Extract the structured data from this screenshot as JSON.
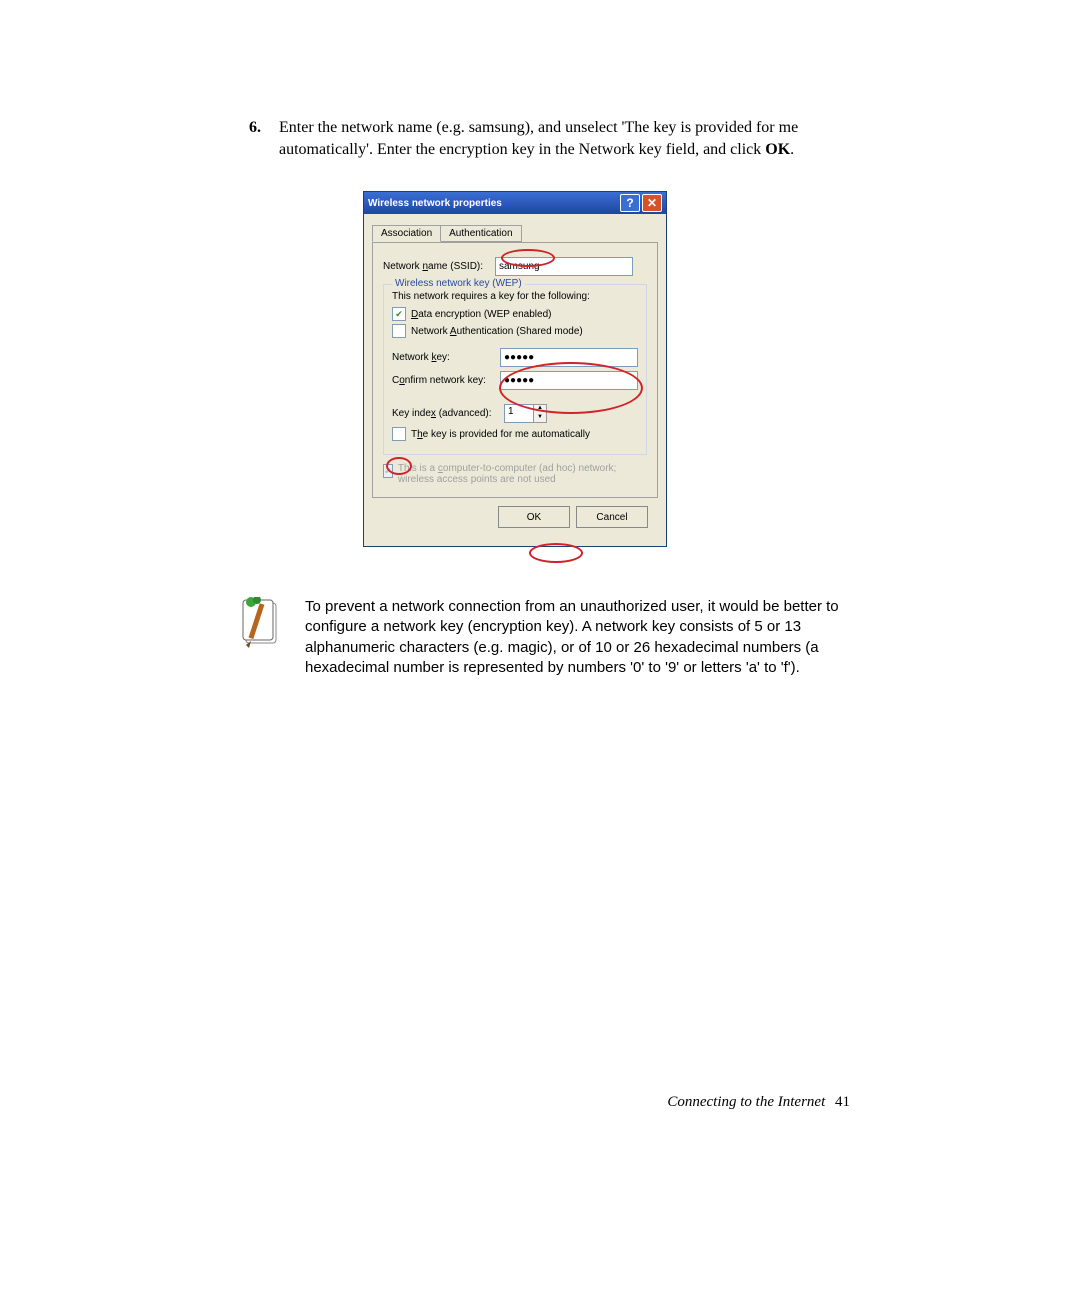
{
  "step": {
    "number": "6.",
    "text_before_bold": "Enter the network name (e.g. samsung), and unselect 'The key is provided for me automatically'. Enter the encryption key in the Network key field, and click ",
    "bold_word": "OK",
    "text_after_bold": "."
  },
  "dialog": {
    "title": "Wireless network properties",
    "tabs": {
      "association": "Association",
      "authentication": "Authentication"
    },
    "ssid_label_pre": "Network ",
    "ssid_label_u": "n",
    "ssid_label_post": "ame (SSID):",
    "ssid_value": "samsung",
    "legend": "Wireless network key (WEP)",
    "req_text": "This network requires a key for the following:",
    "chk_data_pre": "",
    "chk_data_u": "D",
    "chk_data_post": "ata encryption (WEP enabled)",
    "chk_auth_pre": "Network ",
    "chk_auth_u": "A",
    "chk_auth_post": "uthentication (Shared mode)",
    "key_label_pre": "Network ",
    "key_label_u": "k",
    "key_label_post": "ey:",
    "key_value": "●●●●●",
    "confirm_label_pre": "C",
    "confirm_label_u": "o",
    "confirm_label_post": "nfirm network key:",
    "confirm_value": "●●●●●",
    "index_label_pre": "Key inde",
    "index_label_u": "x",
    "index_label_post": " (advanced):",
    "index_value": "1",
    "auto_label_pre": "T",
    "auto_label_u": "h",
    "auto_label_post": "e key is provided for me automatically",
    "adhoc_pre": "This is a ",
    "adhoc_u": "c",
    "adhoc_post": "omputer-to-computer (ad hoc) network; wireless access points are not used",
    "ok": "OK",
    "cancel": "Cancel"
  },
  "note_text": "To prevent a network connection from an unauthorized user, it would be better to configure a network key (encryption key). A network key consists of 5 or 13 alphanumeric characters (e.g. magic), or of 10 or 26 hexadecimal numbers (a hexadecimal number is represented by numbers '0' to '9' or letters 'a' to 'f').",
  "footer": {
    "section": "Connecting to the Internet",
    "page": "41"
  }
}
